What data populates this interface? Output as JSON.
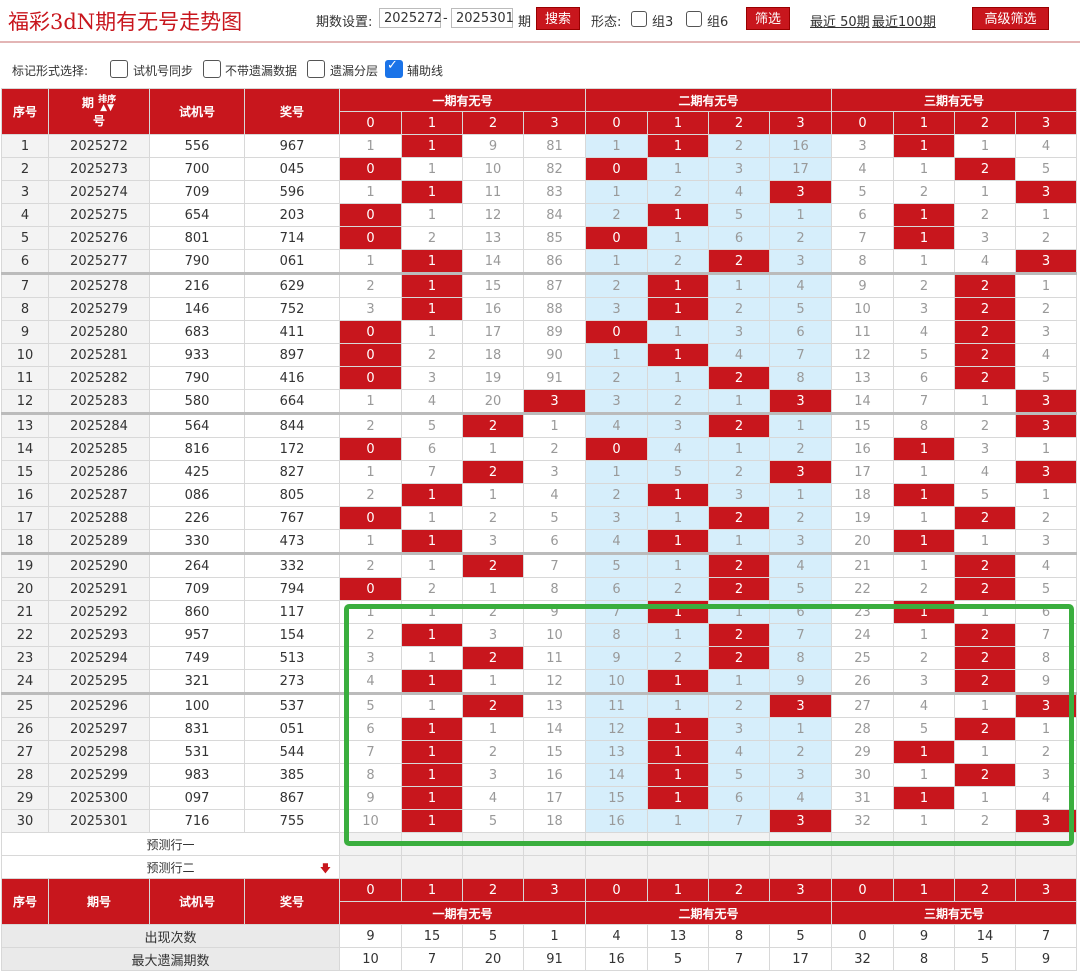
{
  "header": {
    "title": "福彩3dN期有无号走势图",
    "period_label": "期数设置:",
    "period_from": "2025272",
    "period_dash": "-",
    "period_to": "2025301",
    "period_unit": "期",
    "search_label": "搜索",
    "form_label": "形态:",
    "group3_label": "组3",
    "group6_label": "组6",
    "filter_label": "筛选",
    "recent50": "最近 50期",
    "recent100": "最近100期",
    "advanced_label": "高级筛选"
  },
  "options": {
    "label": "标记形式选择:",
    "items": [
      {
        "label": "试机号同步",
        "checked": false
      },
      {
        "label": "不带遗漏数据",
        "checked": false
      },
      {
        "label": "遗漏分层",
        "checked": false
      },
      {
        "label": "辅助线",
        "checked": true
      }
    ]
  },
  "table": {
    "col_headers": {
      "idx": "序号",
      "period_a": "期",
      "period_b": "号",
      "sort": "排序",
      "trial": "试机号",
      "prize": "奖号"
    },
    "groups": [
      "一期有无号",
      "二期有无号",
      "三期有无号"
    ],
    "sub_labels": [
      "0",
      "1",
      "2",
      "3"
    ],
    "rows": [
      {
        "i": "1",
        "p": "2025272",
        "t": "556",
        "z": "967",
        "g": [
          [
            "1",
            "1",
            "9",
            "81"
          ],
          [
            "1",
            "1",
            "2",
            "16"
          ],
          [
            "3",
            "1",
            "1",
            "4"
          ]
        ]
      },
      {
        "i": "2",
        "p": "2025273",
        "t": "700",
        "z": "045",
        "g": [
          [
            "0",
            "1",
            "10",
            "82"
          ],
          [
            "0",
            "1",
            "3",
            "17"
          ],
          [
            "4",
            "1",
            "2",
            "5"
          ]
        ]
      },
      {
        "i": "3",
        "p": "2025274",
        "t": "709",
        "z": "596",
        "g": [
          [
            "1",
            "1",
            "11",
            "83"
          ],
          [
            "1",
            "2",
            "4",
            "3"
          ],
          [
            "5",
            "2",
            "1",
            "3"
          ]
        ]
      },
      {
        "i": "4",
        "p": "2025275",
        "t": "654",
        "z": "203",
        "g": [
          [
            "0",
            "1",
            "12",
            "84"
          ],
          [
            "2",
            "1",
            "5",
            "1"
          ],
          [
            "6",
            "1",
            "2",
            "1"
          ]
        ]
      },
      {
        "i": "5",
        "p": "2025276",
        "t": "801",
        "z": "714",
        "g": [
          [
            "0",
            "2",
            "13",
            "85"
          ],
          [
            "0",
            "1",
            "6",
            "2"
          ],
          [
            "7",
            "1",
            "3",
            "2"
          ]
        ]
      },
      {
        "i": "6",
        "p": "2025277",
        "t": "790",
        "z": "061",
        "g": [
          [
            "1",
            "1",
            "14",
            "86"
          ],
          [
            "1",
            "2",
            "2",
            "3"
          ],
          [
            "8",
            "1",
            "4",
            "3"
          ]
        ]
      },
      {
        "i": "7",
        "p": "2025278",
        "t": "216",
        "z": "629",
        "g": [
          [
            "2",
            "1",
            "15",
            "87"
          ],
          [
            "2",
            "1",
            "1",
            "4"
          ],
          [
            "9",
            "2",
            "2",
            "1"
          ]
        ]
      },
      {
        "i": "8",
        "p": "2025279",
        "t": "146",
        "z": "752",
        "g": [
          [
            "3",
            "1",
            "16",
            "88"
          ],
          [
            "3",
            "1",
            "2",
            "5"
          ],
          [
            "10",
            "3",
            "2",
            "2"
          ]
        ]
      },
      {
        "i": "9",
        "p": "2025280",
        "t": "683",
        "z": "411",
        "g": [
          [
            "0",
            "1",
            "17",
            "89"
          ],
          [
            "0",
            "1",
            "3",
            "6"
          ],
          [
            "11",
            "4",
            "2",
            "3"
          ]
        ]
      },
      {
        "i": "10",
        "p": "2025281",
        "t": "933",
        "z": "897",
        "g": [
          [
            "0",
            "2",
            "18",
            "90"
          ],
          [
            "1",
            "1",
            "4",
            "7"
          ],
          [
            "12",
            "5",
            "2",
            "4"
          ]
        ]
      },
      {
        "i": "11",
        "p": "2025282",
        "t": "790",
        "z": "416",
        "g": [
          [
            "0",
            "3",
            "19",
            "91"
          ],
          [
            "2",
            "1",
            "2",
            "8"
          ],
          [
            "13",
            "6",
            "2",
            "5"
          ]
        ]
      },
      {
        "i": "12",
        "p": "2025283",
        "t": "580",
        "z": "664",
        "g": [
          [
            "1",
            "4",
            "20",
            "3"
          ],
          [
            "3",
            "2",
            "1",
            "3"
          ],
          [
            "14",
            "7",
            "1",
            "3"
          ]
        ]
      },
      {
        "i": "13",
        "p": "2025284",
        "t": "564",
        "z": "844",
        "g": [
          [
            "2",
            "5",
            "2",
            "1"
          ],
          [
            "4",
            "3",
            "2",
            "1"
          ],
          [
            "15",
            "8",
            "2",
            "3"
          ]
        ]
      },
      {
        "i": "14",
        "p": "2025285",
        "t": "816",
        "z": "172",
        "g": [
          [
            "0",
            "6",
            "1",
            "2"
          ],
          [
            "0",
            "4",
            "1",
            "2"
          ],
          [
            "16",
            "1",
            "3",
            "1"
          ]
        ]
      },
      {
        "i": "15",
        "p": "2025286",
        "t": "425",
        "z": "827",
        "g": [
          [
            "1",
            "7",
            "2",
            "3"
          ],
          [
            "1",
            "5",
            "2",
            "3"
          ],
          [
            "17",
            "1",
            "4",
            "3"
          ]
        ]
      },
      {
        "i": "16",
        "p": "2025287",
        "t": "086",
        "z": "805",
        "g": [
          [
            "2",
            "1",
            "1",
            "4"
          ],
          [
            "2",
            "1",
            "3",
            "1"
          ],
          [
            "18",
            "1",
            "5",
            "1"
          ]
        ]
      },
      {
        "i": "17",
        "p": "2025288",
        "t": "226",
        "z": "767",
        "g": [
          [
            "0",
            "1",
            "2",
            "5"
          ],
          [
            "3",
            "1",
            "2",
            "2"
          ],
          [
            "19",
            "1",
            "2",
            "2"
          ]
        ]
      },
      {
        "i": "18",
        "p": "2025289",
        "t": "330",
        "z": "473",
        "g": [
          [
            "1",
            "1",
            "3",
            "6"
          ],
          [
            "4",
            "1",
            "1",
            "3"
          ],
          [
            "20",
            "1",
            "1",
            "3"
          ]
        ]
      },
      {
        "i": "19",
        "p": "2025290",
        "t": "264",
        "z": "332",
        "g": [
          [
            "2",
            "1",
            "2",
            "7"
          ],
          [
            "5",
            "1",
            "2",
            "4"
          ],
          [
            "21",
            "1",
            "2",
            "4"
          ]
        ]
      },
      {
        "i": "20",
        "p": "2025291",
        "t": "709",
        "z": "794",
        "g": [
          [
            "0",
            "2",
            "1",
            "8"
          ],
          [
            "6",
            "2",
            "2",
            "5"
          ],
          [
            "22",
            "2",
            "2",
            "5"
          ]
        ]
      },
      {
        "i": "21",
        "p": "2025292",
        "t": "860",
        "z": "117",
        "g": [
          [
            "1",
            "1",
            "2",
            "9"
          ],
          [
            "7",
            "1",
            "1",
            "6"
          ],
          [
            "23",
            "1",
            "1",
            "6"
          ]
        ]
      },
      {
        "i": "22",
        "p": "2025293",
        "t": "957",
        "z": "154",
        "g": [
          [
            "2",
            "1",
            "3",
            "10"
          ],
          [
            "8",
            "1",
            "2",
            "7"
          ],
          [
            "24",
            "1",
            "2",
            "7"
          ]
        ]
      },
      {
        "i": "23",
        "p": "2025294",
        "t": "749",
        "z": "513",
        "g": [
          [
            "3",
            "1",
            "2",
            "11"
          ],
          [
            "9",
            "2",
            "2",
            "8"
          ],
          [
            "25",
            "2",
            "2",
            "8"
          ]
        ]
      },
      {
        "i": "24",
        "p": "2025295",
        "t": "321",
        "z": "273",
        "g": [
          [
            "4",
            "1",
            "1",
            "12"
          ],
          [
            "10",
            "1",
            "1",
            "9"
          ],
          [
            "26",
            "3",
            "2",
            "9"
          ]
        ]
      },
      {
        "i": "25",
        "p": "2025296",
        "t": "100",
        "z": "537",
        "g": [
          [
            "5",
            "1",
            "2",
            "13"
          ],
          [
            "11",
            "1",
            "2",
            "3"
          ],
          [
            "27",
            "4",
            "1",
            "3"
          ]
        ]
      },
      {
        "i": "26",
        "p": "2025297",
        "t": "831",
        "z": "051",
        "g": [
          [
            "6",
            "1",
            "1",
            "14"
          ],
          [
            "12",
            "1",
            "3",
            "1"
          ],
          [
            "28",
            "5",
            "2",
            "1"
          ]
        ]
      },
      {
        "i": "27",
        "p": "2025298",
        "t": "531",
        "z": "544",
        "g": [
          [
            "7",
            "1",
            "2",
            "15"
          ],
          [
            "13",
            "1",
            "4",
            "2"
          ],
          [
            "29",
            "1",
            "1",
            "2"
          ]
        ]
      },
      {
        "i": "28",
        "p": "2025299",
        "t": "983",
        "z": "385",
        "g": [
          [
            "8",
            "1",
            "3",
            "16"
          ],
          [
            "14",
            "1",
            "5",
            "3"
          ],
          [
            "30",
            "1",
            "2",
            "3"
          ]
        ]
      },
      {
        "i": "29",
        "p": "2025300",
        "t": "097",
        "z": "867",
        "g": [
          [
            "9",
            "1",
            "4",
            "17"
          ],
          [
            "15",
            "1",
            "6",
            "4"
          ],
          [
            "31",
            "1",
            "1",
            "4"
          ]
        ]
      },
      {
        "i": "30",
        "p": "2025301",
        "t": "716",
        "z": "755",
        "g": [
          [
            "10",
            "1",
            "5",
            "18"
          ],
          [
            "16",
            "1",
            "7",
            "3"
          ],
          [
            "32",
            "1",
            "2",
            "3"
          ]
        ]
      }
    ],
    "hits": [
      [
        [
          1
        ],
        [
          1
        ],
        [
          1
        ]
      ],
      [
        [
          0
        ],
        [
          0
        ],
        [
          2
        ]
      ],
      [
        [
          1
        ],
        [
          3
        ],
        [
          3
        ]
      ],
      [
        [
          0
        ],
        [
          1
        ],
        [
          1
        ]
      ],
      [
        [
          0
        ],
        [
          0
        ],
        [
          1
        ]
      ],
      [
        [
          1
        ],
        [
          2
        ],
        [
          3
        ]
      ],
      [
        [
          1
        ],
        [
          1
        ],
        [
          2
        ]
      ],
      [
        [
          1
        ],
        [
          1
        ],
        [
          2
        ]
      ],
      [
        [
          0
        ],
        [
          0
        ],
        [
          2
        ]
      ],
      [
        [
          0
        ],
        [
          1
        ],
        [
          2
        ]
      ],
      [
        [
          0
        ],
        [
          2
        ],
        [
          2
        ]
      ],
      [
        [
          3
        ],
        [
          3
        ],
        [
          3
        ]
      ],
      [
        [
          2
        ],
        [
          2
        ],
        [
          3
        ]
      ],
      [
        [
          0
        ],
        [
          0
        ],
        [
          1
        ]
      ],
      [
        [
          2
        ],
        [
          3
        ],
        [
          3
        ]
      ],
      [
        [
          1
        ],
        [
          1
        ],
        [
          1
        ]
      ],
      [
        [
          0
        ],
        [
          2
        ],
        [
          2
        ]
      ],
      [
        [
          1
        ],
        [
          1
        ],
        [
          1
        ]
      ],
      [
        [
          2
        ],
        [
          2
        ],
        [
          2
        ]
      ],
      [
        [
          0
        ],
        [
          2
        ],
        [
          2
        ]
      ],
      [
        [],
        [
          1
        ],
        [
          1
        ]
      ],
      [
        [
          1
        ],
        [
          2
        ],
        [
          2
        ]
      ],
      [
        [
          2
        ],
        [
          2
        ],
        [
          2
        ]
      ],
      [
        [
          1
        ],
        [
          1
        ],
        [
          2
        ]
      ],
      [
        [
          2
        ],
        [
          3
        ],
        [
          3
        ]
      ],
      [
        [
          1
        ],
        [
          1
        ],
        [
          2
        ]
      ],
      [
        [
          1
        ],
        [
          1
        ],
        [
          1
        ]
      ],
      [
        [
          1
        ],
        [
          1
        ],
        [
          2
        ]
      ],
      [
        [
          1
        ],
        [
          1
        ],
        [
          1
        ]
      ],
      [
        [
          1
        ],
        [
          3
        ],
        [
          3
        ]
      ]
    ],
    "predict_rows": [
      "预测行一",
      "预测行二"
    ],
    "footer_groups": [
      "一期有无号",
      "二期有无号",
      "三期有无号"
    ],
    "stats": [
      {
        "label": "出现次数",
        "values": [
          "9",
          "15",
          "5",
          "1",
          "4",
          "13",
          "8",
          "5",
          "0",
          "9",
          "14",
          "7"
        ]
      },
      {
        "label": "最大遗漏期数",
        "values": [
          "10",
          "7",
          "20",
          "91",
          "16",
          "5",
          "7",
          "17",
          "32",
          "8",
          "5",
          "9"
        ]
      }
    ]
  }
}
